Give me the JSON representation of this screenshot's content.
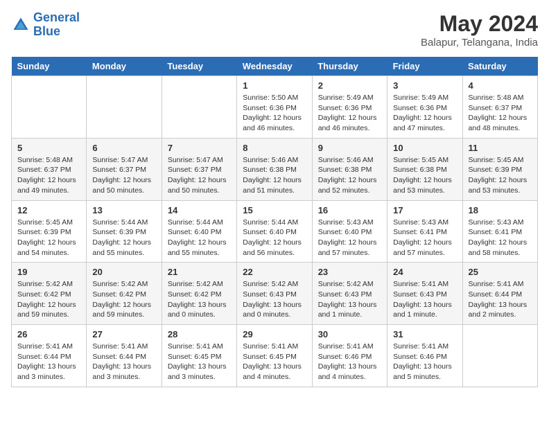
{
  "header": {
    "logo_line1": "General",
    "logo_line2": "Blue",
    "month": "May 2024",
    "location": "Balapur, Telangana, India"
  },
  "days_of_week": [
    "Sunday",
    "Monday",
    "Tuesday",
    "Wednesday",
    "Thursday",
    "Friday",
    "Saturday"
  ],
  "weeks": [
    [
      {
        "day": "",
        "info": ""
      },
      {
        "day": "",
        "info": ""
      },
      {
        "day": "",
        "info": ""
      },
      {
        "day": "1",
        "info": "Sunrise: 5:50 AM\nSunset: 6:36 PM\nDaylight: 12 hours\nand 46 minutes."
      },
      {
        "day": "2",
        "info": "Sunrise: 5:49 AM\nSunset: 6:36 PM\nDaylight: 12 hours\nand 46 minutes."
      },
      {
        "day": "3",
        "info": "Sunrise: 5:49 AM\nSunset: 6:36 PM\nDaylight: 12 hours\nand 47 minutes."
      },
      {
        "day": "4",
        "info": "Sunrise: 5:48 AM\nSunset: 6:37 PM\nDaylight: 12 hours\nand 48 minutes."
      }
    ],
    [
      {
        "day": "5",
        "info": "Sunrise: 5:48 AM\nSunset: 6:37 PM\nDaylight: 12 hours\nand 49 minutes."
      },
      {
        "day": "6",
        "info": "Sunrise: 5:47 AM\nSunset: 6:37 PM\nDaylight: 12 hours\nand 50 minutes."
      },
      {
        "day": "7",
        "info": "Sunrise: 5:47 AM\nSunset: 6:37 PM\nDaylight: 12 hours\nand 50 minutes."
      },
      {
        "day": "8",
        "info": "Sunrise: 5:46 AM\nSunset: 6:38 PM\nDaylight: 12 hours\nand 51 minutes."
      },
      {
        "day": "9",
        "info": "Sunrise: 5:46 AM\nSunset: 6:38 PM\nDaylight: 12 hours\nand 52 minutes."
      },
      {
        "day": "10",
        "info": "Sunrise: 5:45 AM\nSunset: 6:38 PM\nDaylight: 12 hours\nand 53 minutes."
      },
      {
        "day": "11",
        "info": "Sunrise: 5:45 AM\nSunset: 6:39 PM\nDaylight: 12 hours\nand 53 minutes."
      }
    ],
    [
      {
        "day": "12",
        "info": "Sunrise: 5:45 AM\nSunset: 6:39 PM\nDaylight: 12 hours\nand 54 minutes."
      },
      {
        "day": "13",
        "info": "Sunrise: 5:44 AM\nSunset: 6:39 PM\nDaylight: 12 hours\nand 55 minutes."
      },
      {
        "day": "14",
        "info": "Sunrise: 5:44 AM\nSunset: 6:40 PM\nDaylight: 12 hours\nand 55 minutes."
      },
      {
        "day": "15",
        "info": "Sunrise: 5:44 AM\nSunset: 6:40 PM\nDaylight: 12 hours\nand 56 minutes."
      },
      {
        "day": "16",
        "info": "Sunrise: 5:43 AM\nSunset: 6:40 PM\nDaylight: 12 hours\nand 57 minutes."
      },
      {
        "day": "17",
        "info": "Sunrise: 5:43 AM\nSunset: 6:41 PM\nDaylight: 12 hours\nand 57 minutes."
      },
      {
        "day": "18",
        "info": "Sunrise: 5:43 AM\nSunset: 6:41 PM\nDaylight: 12 hours\nand 58 minutes."
      }
    ],
    [
      {
        "day": "19",
        "info": "Sunrise: 5:42 AM\nSunset: 6:42 PM\nDaylight: 12 hours\nand 59 minutes."
      },
      {
        "day": "20",
        "info": "Sunrise: 5:42 AM\nSunset: 6:42 PM\nDaylight: 12 hours\nand 59 minutes."
      },
      {
        "day": "21",
        "info": "Sunrise: 5:42 AM\nSunset: 6:42 PM\nDaylight: 13 hours\nand 0 minutes."
      },
      {
        "day": "22",
        "info": "Sunrise: 5:42 AM\nSunset: 6:43 PM\nDaylight: 13 hours\nand 0 minutes."
      },
      {
        "day": "23",
        "info": "Sunrise: 5:42 AM\nSunset: 6:43 PM\nDaylight: 13 hours\nand 1 minute."
      },
      {
        "day": "24",
        "info": "Sunrise: 5:41 AM\nSunset: 6:43 PM\nDaylight: 13 hours\nand 1 minute."
      },
      {
        "day": "25",
        "info": "Sunrise: 5:41 AM\nSunset: 6:44 PM\nDaylight: 13 hours\nand 2 minutes."
      }
    ],
    [
      {
        "day": "26",
        "info": "Sunrise: 5:41 AM\nSunset: 6:44 PM\nDaylight: 13 hours\nand 3 minutes."
      },
      {
        "day": "27",
        "info": "Sunrise: 5:41 AM\nSunset: 6:44 PM\nDaylight: 13 hours\nand 3 minutes."
      },
      {
        "day": "28",
        "info": "Sunrise: 5:41 AM\nSunset: 6:45 PM\nDaylight: 13 hours\nand 3 minutes."
      },
      {
        "day": "29",
        "info": "Sunrise: 5:41 AM\nSunset: 6:45 PM\nDaylight: 13 hours\nand 4 minutes."
      },
      {
        "day": "30",
        "info": "Sunrise: 5:41 AM\nSunset: 6:46 PM\nDaylight: 13 hours\nand 4 minutes."
      },
      {
        "day": "31",
        "info": "Sunrise: 5:41 AM\nSunset: 6:46 PM\nDaylight: 13 hours\nand 5 minutes."
      },
      {
        "day": "",
        "info": ""
      }
    ]
  ]
}
